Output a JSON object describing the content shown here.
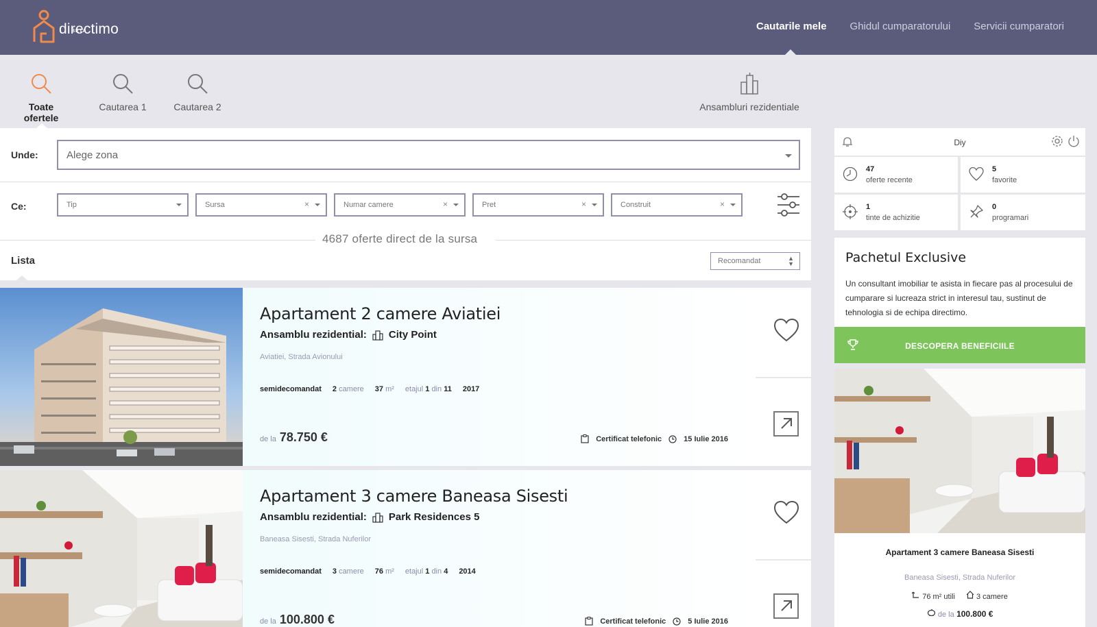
{
  "header": {
    "logo_text": "directimo",
    "logo_badge": "BETA",
    "nav": [
      "Cautarile mele",
      "Ghidul cumparatorului",
      "Servicii cumparatori"
    ]
  },
  "tabs": {
    "all": "Toate ofertele",
    "s1": "Cautarea 1",
    "s2": "Cautarea 2",
    "ans": "Ansambluri rezidentiale"
  },
  "filters": {
    "where_label": "Unde:",
    "zone_placeholder": "Alege zona",
    "what_label": "Ce:",
    "tip": "Tip",
    "sursa": "Sursa",
    "camere": "Numar camere",
    "pret": "Pret",
    "construit": "Construit",
    "clear": "×"
  },
  "results": {
    "count_text": "4687 oferte direct de la sursa",
    "list_label": "Lista",
    "sort": "Recomandat"
  },
  "listings": [
    {
      "title": "Apartament 2 camere Aviatiei",
      "ans_label": "Ansamblu rezidential:",
      "ans_name": "City Point",
      "address": "Aviatiei, Strada Avionului",
      "finish": "semidecomandat",
      "rooms": "2",
      "rooms_unit": "camere",
      "area": "37",
      "area_unit": "m²",
      "floor_label": "etajul",
      "floor": "1",
      "floor_of": "din",
      "floors_total": "11",
      "year": "2017",
      "price_prefix": "de la",
      "price": "78.750 €",
      "cert": "Certificat telefonic",
      "date": "15 Iulie 2016"
    },
    {
      "title": "Apartament 3 camere Baneasa Sisesti",
      "ans_label": "Ansamblu rezidential:",
      "ans_name": "Park Residences 5",
      "address": "Baneasa Sisesti, Strada Nuferilor",
      "finish": "semidecomandat",
      "rooms": "3",
      "rooms_unit": "camere",
      "area": "76",
      "area_unit": "m²",
      "floor_label": "etajul",
      "floor": "1",
      "floor_of": "din",
      "floors_total": "4",
      "year": "2014",
      "price_prefix": "de la",
      "price": "100.800 €",
      "cert": "Certificat telefonic",
      "date": "5 Iulie 2016"
    }
  ],
  "sidebar": {
    "user": "Diy",
    "stats": [
      {
        "num": "47",
        "label": "oferte recente",
        "icon": "clock-icon"
      },
      {
        "num": "5",
        "label": "favorite",
        "icon": "heart-icon"
      },
      {
        "num": "1",
        "label": "tinte de achizitie",
        "icon": "target-icon"
      },
      {
        "num": "0",
        "label": "programari",
        "icon": "pin-icon"
      }
    ],
    "package_title": "Pachetul Exclusive",
    "package_text": "Un consultant imobiliar te asista in fiecare pas al procesului de cumparare si lucreaza strict in interesul tau, sustinut de tehnologia si de echipa directimo.",
    "cta": "DESCOPERA BENEFICIILE",
    "featured": {
      "title": "Apartament 3 camere Baneasa Sisesti",
      "address": "Baneasa Sisesti, Strada Nuferilor",
      "area": "76 m² utili",
      "rooms": "3 camere",
      "price_prefix": "de la",
      "price": "100.800 €"
    }
  },
  "colors": {
    "header": "#5b5b7c",
    "accent": "#f08a4b",
    "cta": "#7dc45a",
    "border": "#8f8fae"
  }
}
